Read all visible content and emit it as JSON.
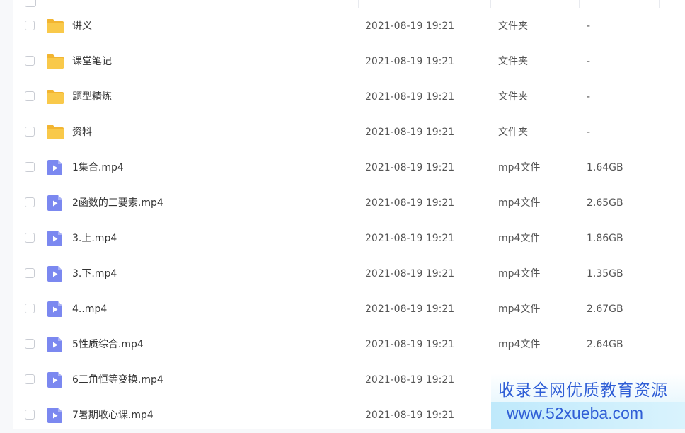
{
  "colors": {
    "folder": "#f9c94a",
    "folder_tab": "#f2b531",
    "video": "#7b88f0",
    "watermark_text": "#2f5ed6"
  },
  "files": [
    {
      "name": "讲义",
      "date": "2021-08-19 19:21",
      "type": "文件夹",
      "size": "-",
      "icon": "folder-icon"
    },
    {
      "name": "课堂笔记",
      "date": "2021-08-19 19:21",
      "type": "文件夹",
      "size": "-",
      "icon": "folder-icon"
    },
    {
      "name": "题型精炼",
      "date": "2021-08-19 19:21",
      "type": "文件夹",
      "size": "-",
      "icon": "folder-icon"
    },
    {
      "name": "资料",
      "date": "2021-08-19 19:21",
      "type": "文件夹",
      "size": "-",
      "icon": "folder-icon"
    },
    {
      "name": "1集合.mp4",
      "date": "2021-08-19 19:21",
      "type": "mp4文件",
      "size": "1.64GB",
      "icon": "video-file-icon"
    },
    {
      "name": "2函数的三要素.mp4",
      "date": "2021-08-19 19:21",
      "type": "mp4文件",
      "size": "2.65GB",
      "icon": "video-file-icon"
    },
    {
      "name": "3.上.mp4",
      "date": "2021-08-19 19:21",
      "type": "mp4文件",
      "size": "1.86GB",
      "icon": "video-file-icon"
    },
    {
      "name": "3.下.mp4",
      "date": "2021-08-19 19:21",
      "type": "mp4文件",
      "size": "1.35GB",
      "icon": "video-file-icon"
    },
    {
      "name": "4..mp4",
      "date": "2021-08-19 19:21",
      "type": "mp4文件",
      "size": "2.67GB",
      "icon": "video-file-icon"
    },
    {
      "name": "5性质综合.mp4",
      "date": "2021-08-19 19:21",
      "type": "mp4文件",
      "size": "2.64GB",
      "icon": "video-file-icon"
    },
    {
      "name": "6三角恒等变换.mp4",
      "date": "2021-08-19 19:21",
      "type": "",
      "size": "",
      "icon": "video-file-icon"
    },
    {
      "name": "7暑期收心课.mp4",
      "date": "2021-08-19 19:21",
      "type": "",
      "size": "",
      "icon": "video-file-icon"
    }
  ],
  "watermark": {
    "line1": "收录全网优质教育资源",
    "line2": "www.52xueba.com"
  }
}
